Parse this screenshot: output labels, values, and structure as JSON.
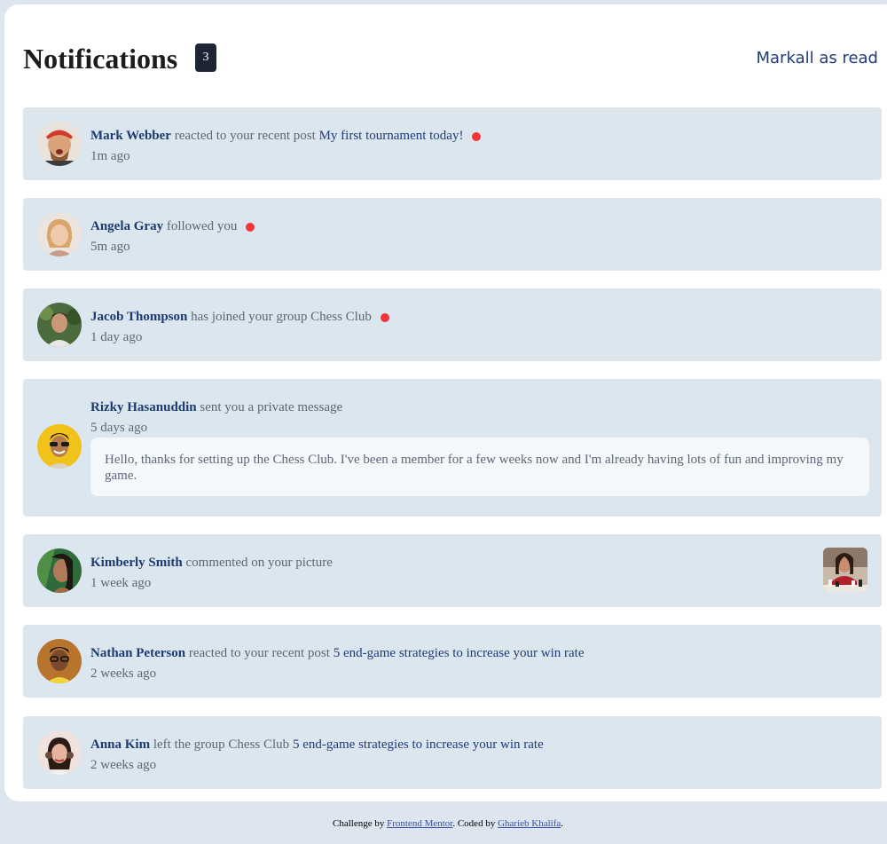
{
  "header": {
    "title": "Notifications",
    "unread_count": "3",
    "mark_all_label": "Markall as read"
  },
  "notifications": [
    {
      "name": "Mark Webber",
      "action": "reacted to your recent post",
      "target": "My first tournament today!",
      "time": "1m ago",
      "unread": true
    },
    {
      "name": "Angela Gray",
      "action": "followed you",
      "target": "",
      "time": "5m ago",
      "unread": true
    },
    {
      "name": "Jacob Thompson",
      "action": "has joined your group Chess Club",
      "target": "",
      "time": "1 day ago",
      "unread": true
    },
    {
      "name": "Rizky Hasanuddin",
      "action": "sent you a private message",
      "target": "",
      "time": "5 days ago",
      "unread": false,
      "message": "Hello, thanks for setting up the Chess Club. I've been a member for a few weeks now and I'm already having lots of fun and improving my game."
    },
    {
      "name": "Kimberly Smith",
      "action": "commented on your picture",
      "target": "",
      "time": "1 week ago",
      "unread": false
    },
    {
      "name": "Nathan Peterson",
      "action": "reacted to your recent post",
      "target": "5 end-game strategies to increase your win rate",
      "time": "2 weeks ago",
      "unread": false
    },
    {
      "name": "Anna Kim",
      "action": "left the group Chess Club",
      "target": "5 end-game strategies to increase your win rate",
      "time": "2 weeks ago",
      "unread": false
    }
  ],
  "footer": {
    "prefix": "Challenge by",
    "link1": "Frontend Mentor",
    "middle": ". Coded by",
    "link2": "Gharieb Khalifa",
    "suffix": "."
  },
  "colors": {
    "background": "#dde6ee",
    "card": "#ffffff",
    "notification_bg": "#dce6ee",
    "name": "#1c3b70",
    "unread_dot": "#f4343a",
    "badge": "#1d2433"
  }
}
